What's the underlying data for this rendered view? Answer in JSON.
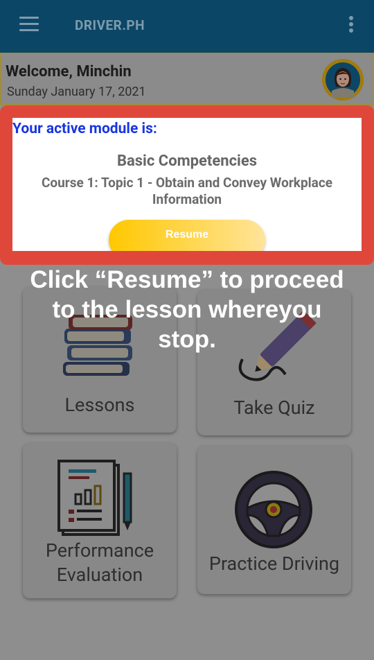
{
  "appbar": {
    "title": "DRIVER.PH"
  },
  "welcome": {
    "greeting": "Welcome, Minchin",
    "date": "Sunday January 17, 2021"
  },
  "module": {
    "heading": "Your active module is:",
    "title": "Basic Competencies",
    "subtitle": "Course 1: Topic 1 - Obtain and Convey Workplace Information",
    "resume_label": "Resume"
  },
  "tiles": {
    "lessons": "Lessons",
    "take_quiz": "Take Quiz",
    "performance_line1": "Performance",
    "performance_line2": "Evaluation",
    "practice_driving": "Practice Driving"
  },
  "instruction": "Click “Resume” to proceed to the lesson whereyou stop.",
  "colors": {
    "appbar": "#0b4666",
    "highlight": "#e0473b",
    "module_heading": "#1a35e0",
    "resume_button": "#ffc800"
  }
}
